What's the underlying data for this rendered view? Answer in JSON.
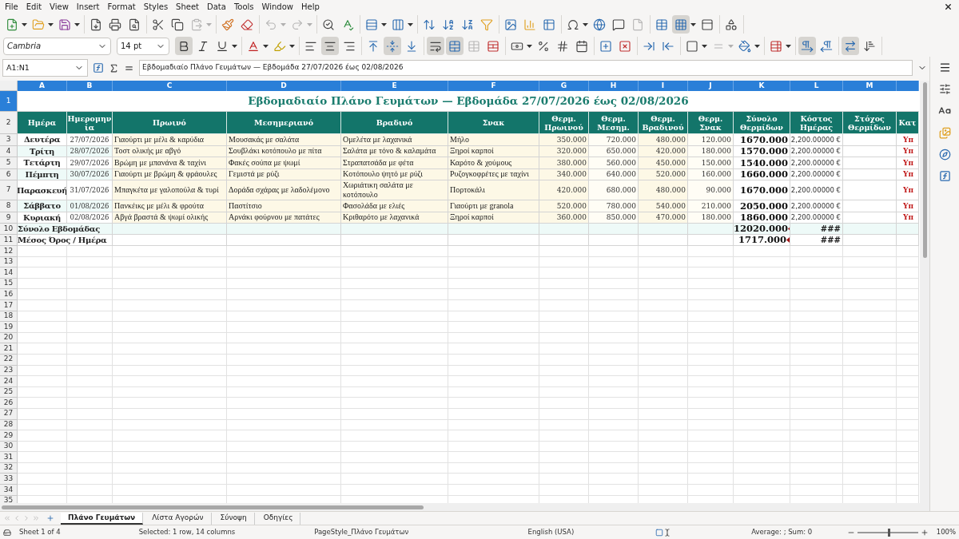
{
  "menu": [
    "File",
    "Edit",
    "View",
    "Insert",
    "Format",
    "Styles",
    "Sheet",
    "Data",
    "Tools",
    "Window",
    "Help"
  ],
  "standard_toolbar": [
    {
      "items": [
        {
          "kind": "new",
          "dropdown": true,
          "pressed": false,
          "disabled": false
        },
        {
          "kind": "open",
          "dropdown": true,
          "pressed": false,
          "disabled": false
        },
        {
          "kind": "save",
          "dropdown": true,
          "pressed": false,
          "disabled": false
        }
      ]
    },
    {
      "items": [
        {
          "kind": "export_pdf",
          "dropdown": false,
          "pressed": false,
          "disabled": false
        },
        {
          "kind": "print",
          "dropdown": false,
          "pressed": false,
          "disabled": false
        },
        {
          "kind": "print_preview",
          "dropdown": false,
          "pressed": false,
          "disabled": false
        }
      ]
    },
    {
      "items": [
        {
          "kind": "cut",
          "dropdown": false,
          "pressed": false,
          "disabled": false
        },
        {
          "kind": "copy",
          "dropdown": false,
          "pressed": false,
          "disabled": false
        },
        {
          "kind": "paste",
          "dropdown": true,
          "pressed": false,
          "disabled": true
        }
      ]
    },
    {
      "items": [
        {
          "kind": "clone_format",
          "dropdown": false,
          "pressed": false,
          "disabled": false
        },
        {
          "kind": "clear_format",
          "dropdown": false,
          "pressed": false,
          "disabled": false
        }
      ]
    },
    {
      "items": [
        {
          "kind": "undo",
          "dropdown": true,
          "pressed": false,
          "disabled": true
        },
        {
          "kind": "redo",
          "dropdown": true,
          "pressed": false,
          "disabled": true
        }
      ]
    },
    {
      "items": [
        {
          "kind": "find_replace",
          "dropdown": false,
          "pressed": false,
          "disabled": false
        },
        {
          "kind": "spelling",
          "dropdown": false,
          "pressed": false,
          "disabled": false
        }
      ]
    },
    {
      "items": [
        {
          "kind": "row",
          "dropdown": true,
          "pressed": false,
          "disabled": false
        },
        {
          "kind": "column",
          "dropdown": true,
          "pressed": false,
          "disabled": false
        }
      ]
    },
    {
      "items": [
        {
          "kind": "sort",
          "dropdown": false,
          "pressed": false,
          "disabled": false
        },
        {
          "kind": "sort_ascending",
          "dropdown": false,
          "pressed": false,
          "disabled": false
        },
        {
          "kind": "sort_descending",
          "dropdown": false,
          "pressed": false,
          "disabled": false
        },
        {
          "kind": "autofilter",
          "dropdown": false,
          "pressed": false,
          "disabled": false
        }
      ]
    },
    {
      "items": [
        {
          "kind": "image",
          "dropdown": false,
          "pressed": false,
          "disabled": false
        },
        {
          "kind": "chart",
          "dropdown": false,
          "pressed": false,
          "disabled": false
        },
        {
          "kind": "pivot_table",
          "dropdown": false,
          "pressed": false,
          "disabled": false
        }
      ]
    },
    {
      "items": [
        {
          "kind": "special_character",
          "dropdown": true,
          "pressed": false,
          "disabled": false
        },
        {
          "kind": "hyperlink",
          "dropdown": false,
          "pressed": false,
          "disabled": false
        },
        {
          "kind": "comment",
          "dropdown": false,
          "pressed": false,
          "disabled": false
        },
        {
          "kind": "headers_footers",
          "dropdown": false,
          "pressed": false,
          "disabled": true
        }
      ]
    },
    {
      "items": [
        {
          "kind": "print_area",
          "dropdown": false,
          "pressed": false,
          "disabled": false
        },
        {
          "kind": "freeze_rows_columns",
          "dropdown": true,
          "pressed": true,
          "disabled": false
        },
        {
          "kind": "split_window",
          "dropdown": false,
          "pressed": false,
          "disabled": false
        }
      ]
    },
    {
      "items": [
        {
          "kind": "shapes",
          "dropdown": false,
          "pressed": false,
          "disabled": false
        }
      ]
    }
  ],
  "font_name": "Cambria",
  "font_size": "14 pt",
  "format_toolbar": [
    {
      "items": [
        {
          "kind": "bold",
          "dropdown": false,
          "pressed": true,
          "disabled": false
        },
        {
          "kind": "italic",
          "dropdown": false,
          "pressed": false,
          "disabled": false
        },
        {
          "kind": "underline",
          "dropdown": true,
          "pressed": false,
          "disabled": false
        }
      ]
    },
    {
      "items": [
        {
          "kind": "font_color",
          "dropdown": true,
          "pressed": false,
          "disabled": false
        },
        {
          "kind": "highlighting",
          "dropdown": true,
          "pressed": false,
          "disabled": false
        }
      ]
    },
    {
      "items": [
        {
          "kind": "align_left",
          "dropdown": false,
          "pressed": false,
          "disabled": false
        },
        {
          "kind": "align_center",
          "dropdown": false,
          "pressed": true,
          "disabled": false
        },
        {
          "kind": "align_right",
          "dropdown": false,
          "pressed": false,
          "disabled": false
        }
      ]
    },
    {
      "items": [
        {
          "kind": "align_top",
          "dropdown": false,
          "pressed": false,
          "disabled": false
        },
        {
          "kind": "align_middle",
          "dropdown": false,
          "pressed": true,
          "disabled": false
        },
        {
          "kind": "align_bottom",
          "dropdown": false,
          "pressed": false,
          "disabled": false
        }
      ]
    },
    {
      "items": [
        {
          "kind": "wrap_text",
          "dropdown": false,
          "pressed": true,
          "disabled": false
        },
        {
          "kind": "merge_and_center",
          "dropdown": false,
          "pressed": true,
          "disabled": false
        },
        {
          "kind": "merge_cells",
          "dropdown": false,
          "pressed": false,
          "disabled": true
        },
        {
          "kind": "unmerge_cells",
          "dropdown": false,
          "pressed": false,
          "disabled": false
        }
      ]
    },
    {
      "items": [
        {
          "kind": "number_format",
          "dropdown": true,
          "pressed": false,
          "disabled": false
        },
        {
          "kind": "percent",
          "dropdown": false,
          "pressed": false,
          "disabled": false
        },
        {
          "kind": "number",
          "dropdown": false,
          "pressed": false,
          "disabled": false
        },
        {
          "kind": "date",
          "dropdown": false,
          "pressed": false,
          "disabled": false
        }
      ]
    },
    {
      "items": [
        {
          "kind": "add_decimal",
          "dropdown": false,
          "pressed": false,
          "disabled": false
        },
        {
          "kind": "delete_decimal",
          "dropdown": false,
          "pressed": false,
          "disabled": false
        }
      ]
    },
    {
      "items": [
        {
          "kind": "increase_indent",
          "dropdown": false,
          "pressed": false,
          "disabled": false
        },
        {
          "kind": "decrease_indent",
          "dropdown": false,
          "pressed": false,
          "disabled": false
        }
      ]
    },
    {
      "items": [
        {
          "kind": "borders",
          "dropdown": true,
          "pressed": false,
          "disabled": false
        },
        {
          "kind": "border_style",
          "dropdown": true,
          "pressed": false,
          "disabled": true
        },
        {
          "kind": "border_color",
          "dropdown": true,
          "pressed": false,
          "disabled": false
        }
      ]
    },
    {
      "items": [
        {
          "kind": "conditional",
          "dropdown": true,
          "pressed": false,
          "disabled": false
        }
      ]
    },
    {
      "items": [
        {
          "kind": "left_to_right",
          "dropdown": false,
          "pressed": true,
          "disabled": false
        },
        {
          "kind": "right_to_left",
          "dropdown": false,
          "pressed": false,
          "disabled": false
        }
      ]
    },
    {
      "items": [
        {
          "kind": "text_horizontal",
          "dropdown": false,
          "pressed": true,
          "disabled": false
        },
        {
          "kind": "text_vertical",
          "dropdown": false,
          "pressed": false,
          "disabled": false
        }
      ]
    }
  ],
  "name_box": "A1:N1",
  "formula": "Εβδομαδιαίο Πλάνο Γευμάτων — Εβδομάδα 27/07/2026 έως 02/08/2026",
  "columns": [
    {
      "letter": "A",
      "selected": true
    },
    {
      "letter": "B",
      "selected": true
    },
    {
      "letter": "C",
      "selected": true
    },
    {
      "letter": "D",
      "selected": true
    },
    {
      "letter": "E",
      "selected": true
    },
    {
      "letter": "F",
      "selected": true
    },
    {
      "letter": "G",
      "selected": true
    },
    {
      "letter": "H",
      "selected": true
    },
    {
      "letter": "I",
      "selected": true
    },
    {
      "letter": "J",
      "selected": true
    },
    {
      "letter": "K",
      "selected": true
    },
    {
      "letter": "L",
      "selected": true
    },
    {
      "letter": "M",
      "selected": true
    }
  ],
  "title_row": {
    "number": "1",
    "selected": true,
    "title": "Εβδομαδιαίο Πλάνο Γευμάτων — Εβδομάδα 27/07/2026 έως 02/08/2026"
  },
  "header_row": {
    "number": "2",
    "selected": false,
    "labels": [
      "Ημέρα",
      "Ημερομηνία",
      "Πρωινό",
      "Μεσημεριανό",
      "Βραδινό",
      "Σνακ",
      "Θερμ. Πρωινού",
      "Θερμ. Μεσημ.",
      "Θερμ. Βραδινού",
      "Θερμ. Σνακ",
      "Σύνολο Θερμίδων",
      "Κόστος Ημέρας",
      "Στόχος Θερμίδων",
      "Κατ"
    ]
  },
  "day_rows": [
    {
      "number": "3",
      "selected": false,
      "day": "Δευτέρα",
      "date": "27/07/2026",
      "breakfast": "Γιαούρτι με μέλι & καρύδια",
      "lunch": "Μουσακάς με σαλάτα",
      "dinner": "Ομελέτα με λαχανικά",
      "snack": "Μήλο",
      "kcal_breakfast": "350.000",
      "kcal_lunch": "720.000",
      "kcal_dinner": "480.000",
      "kcal_snack": "120.000",
      "total": "1670.000",
      "cost": "2,200.00000 €",
      "status": "Υπ"
    },
    {
      "number": "4",
      "selected": false,
      "day": "Τρίτη",
      "date": "28/07/2026",
      "breakfast": "Τοστ ολικής με αβγό",
      "lunch": "Σουβλάκι κοτόπουλο με πίτα",
      "dinner": "Σαλάτα με τόνο & καλαμάτα",
      "snack": "Ξηροί καρποί",
      "kcal_breakfast": "320.000",
      "kcal_lunch": "650.000",
      "kcal_dinner": "420.000",
      "kcal_snack": "180.000",
      "total": "1570.000",
      "cost": "2,200.00000 €",
      "status": "Υπ"
    },
    {
      "number": "5",
      "selected": false,
      "day": "Τετάρτη",
      "date": "29/07/2026",
      "breakfast": "Βρώμη με μπανάνα & ταχίνι",
      "lunch": "Φακές σούπα με ψωμί",
      "dinner": "Στραπατσάδα με φέτα",
      "snack": "Καρότο & χούμους",
      "kcal_breakfast": "380.000",
      "kcal_lunch": "560.000",
      "kcal_dinner": "450.000",
      "kcal_snack": "150.000",
      "total": "1540.000",
      "cost": "2,200.00000 €",
      "status": "Υπ"
    },
    {
      "number": "6",
      "selected": false,
      "day": "Πέμπτη",
      "date": "30/07/2026",
      "breakfast": "Γιαούρτι με βρώμη & φράουλες",
      "lunch": "Γεμιστά με ρύζι",
      "dinner": "Κοτόπουλο ψητό με ρύζι",
      "snack": "Ρυζογκοφρέτες με ταχίνι",
      "kcal_breakfast": "340.000",
      "kcal_lunch": "640.000",
      "kcal_dinner": "520.000",
      "kcal_snack": "160.000",
      "total": "1660.000",
      "cost": "2,200.00000 €",
      "status": "Υπ"
    },
    {
      "number": "7",
      "selected": false,
      "day": "Παρασκευή",
      "date": "31/07/2026",
      "breakfast": "Μπαγκέτα με γαλοπούλα & τυρί",
      "lunch": "Δοράδα σχάρας με λαδολέμονο",
      "dinner": "Χωριάτικη σαλάτα με κοτόπουλο",
      "snack": "Πορτοκάλι",
      "kcal_breakfast": "420.000",
      "kcal_lunch": "680.000",
      "kcal_dinner": "480.000",
      "kcal_snack": "90.000",
      "total": "1670.000",
      "cost": "2,200.00000 €",
      "status": "Υπ"
    },
    {
      "number": "8",
      "selected": false,
      "day": "Σάββατο",
      "date": "01/08/2026",
      "breakfast": "Πανκέικς με μέλι & φρούτα",
      "lunch": "Παστίτσιο",
      "dinner": "Φασολάδα με ελιές",
      "snack": "Γιαούρτι με granola",
      "kcal_breakfast": "520.000",
      "kcal_lunch": "780.000",
      "kcal_dinner": "540.000",
      "kcal_snack": "210.000",
      "total": "2050.000",
      "cost": "2,200.00000 €",
      "status": "Υπ"
    },
    {
      "number": "9",
      "selected": false,
      "day": "Κυριακή",
      "date": "02/08/2026",
      "breakfast": "Αβγά βραστά & ψωμί ολικής",
      "lunch": "Αρνάκι φούρνου με πατάτες",
      "dinner": "Κριθαρότο με λαχανικά",
      "snack": "Ξηροί καρποί",
      "kcal_breakfast": "360.000",
      "kcal_lunch": "850.000",
      "kcal_dinner": "470.000",
      "kcal_snack": "180.000",
      "total": "1860.000",
      "cost": "2,200.00000 €",
      "status": "Υπ"
    }
  ],
  "summary_rows": [
    {
      "number": "10",
      "selected": false,
      "label": "Σύνολο Εβδομάδας",
      "total": "12020.000",
      "total_overflow": true,
      "cost": "###"
    },
    {
      "number": "11",
      "selected": false,
      "label": "Μέσος Όρος / Ημέρα",
      "total": "1717.000",
      "total_overflow": true,
      "cost": "###"
    }
  ],
  "empty_rows": [
    "12",
    "13",
    "14",
    "15",
    "16",
    "17",
    "18",
    "19",
    "20",
    "21",
    "22",
    "23",
    "24",
    "25",
    "26",
    "27",
    "28",
    "29",
    "30",
    "31",
    "32",
    "33",
    "34",
    "35"
  ],
  "sheet_tabs": [
    {
      "label": "Πλάνο Γευμάτων",
      "selected": true
    },
    {
      "label": "Λίστα Αγορών",
      "selected": false
    },
    {
      "label": "Σύνοψη",
      "selected": false
    },
    {
      "label": "Οδηγίες",
      "selected": false
    }
  ],
  "status_bar": {
    "sheet": "Sheet 1 of 4",
    "selection": "Selected: 1 row, 14 columns",
    "page_style": "PageStyle_Πλάνο Γευμάτων",
    "language": "English (USA)",
    "sum": "Average: ; Sum: 0",
    "zoom": "100%",
    "zoom_slider": {
      "level": 0.5
    }
  }
}
